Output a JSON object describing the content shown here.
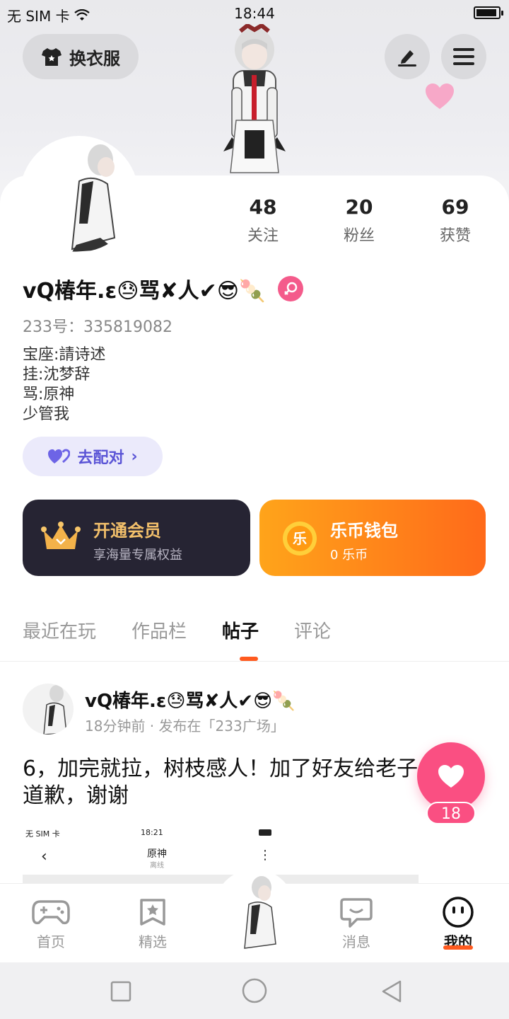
{
  "status_bar": {
    "carrier": "无 SIM 卡",
    "time": "18:44"
  },
  "header": {
    "outfit_label": "换衣服"
  },
  "stats": [
    {
      "value": "48",
      "label": "关注"
    },
    {
      "value": "20",
      "label": "粉丝"
    },
    {
      "value": "69",
      "label": "获赞"
    }
  ],
  "profile": {
    "name": "vQ椿年.ε😓骂✘人✔😎🍡",
    "uid": "233号：335819082",
    "bio": [
      "宝座:請诗述",
      "挂:沈梦辞",
      "骂:原神",
      "少管我"
    ],
    "pair_label": "去配对"
  },
  "vip": {
    "title": "开通会员",
    "subtitle": "享海量专属权益"
  },
  "wallet": {
    "title": "乐币钱包",
    "subtitle": "0 乐币",
    "coin_glyph": "乐"
  },
  "tabs": [
    {
      "label": "最近在玩"
    },
    {
      "label": "作品栏"
    },
    {
      "label": "帖子"
    },
    {
      "label": "评论"
    }
  ],
  "post": {
    "author": "vQ椿年.ε😓骂✘人✔😎🍡",
    "meta": "18分钟前 · 发布在「233广场」",
    "text": "6，加完就拉，树枝感人！加了好友给老子道歉，谢谢",
    "likes": "18",
    "embedded": {
      "carrier": "无 SIM 卡",
      "time": "18:21",
      "title": "原神",
      "subtitle": "离线"
    }
  },
  "bottom_nav": [
    {
      "label": "首页",
      "icon": "gamepad-icon"
    },
    {
      "label": "精选",
      "icon": "star-bookmark-icon"
    },
    {
      "label": "消息",
      "icon": "chat-bubble-icon"
    },
    {
      "label": "我的",
      "icon": "face-icon"
    }
  ],
  "colors": {
    "accent": "#ff5a1f",
    "pink": "#fa4f82",
    "vip_bg": "#262433",
    "wallet_start": "#ffa41a",
    "wallet_end": "#ff6a1a",
    "pair_text": "#5b55d6"
  }
}
